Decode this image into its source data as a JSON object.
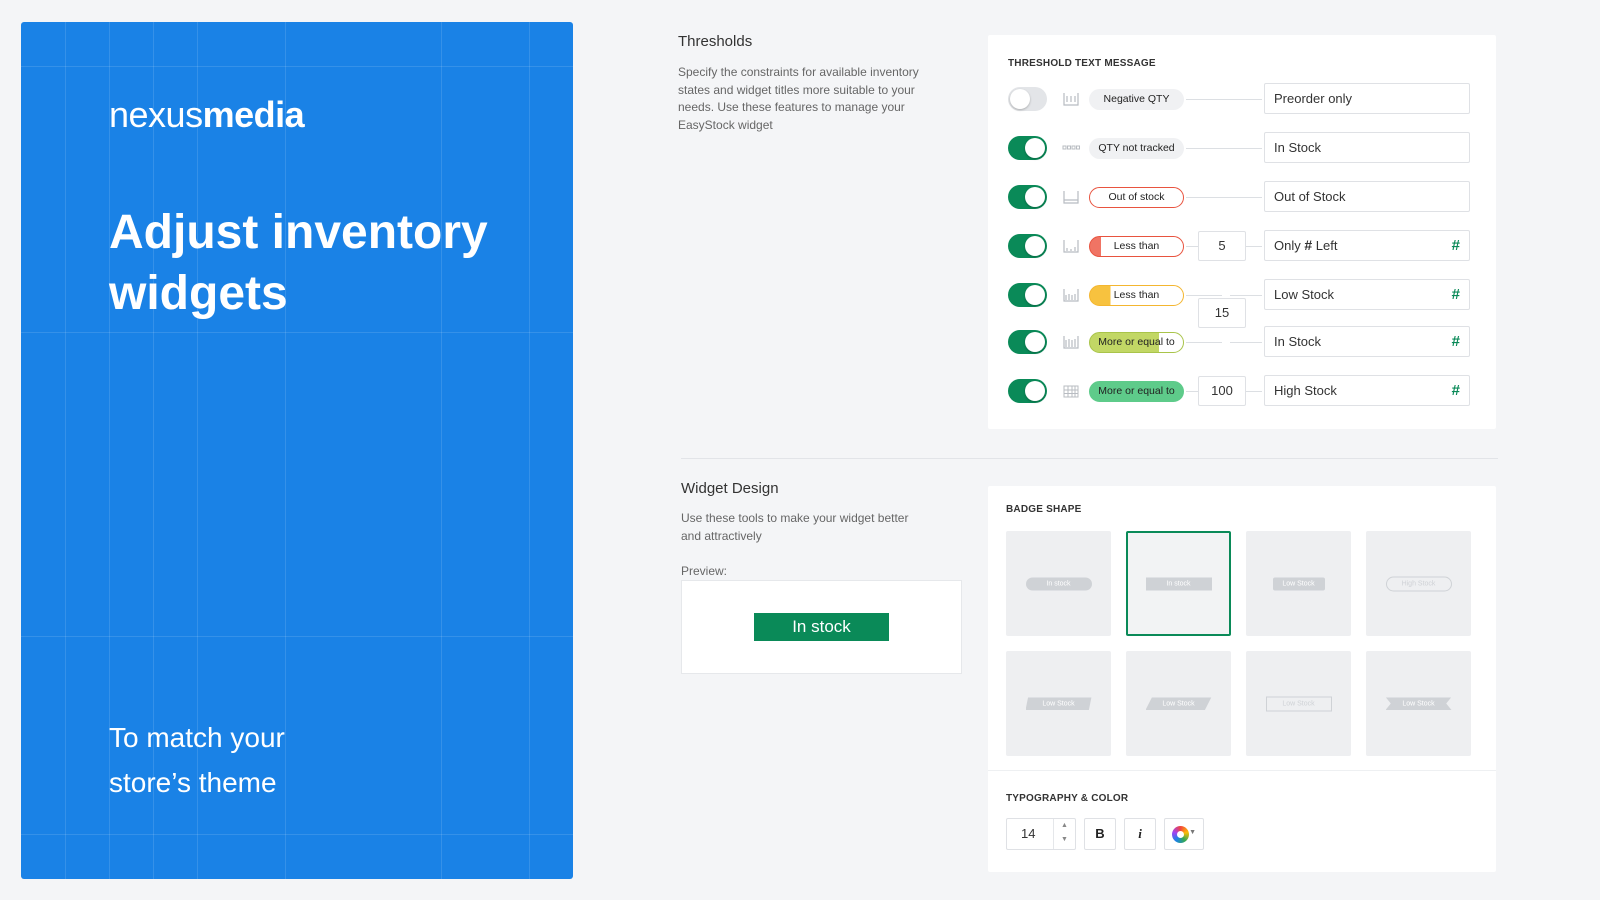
{
  "hero": {
    "brand_light": "nexus",
    "brand_bold": "media",
    "title": "Adjust inventory widgets",
    "subtitle": "To match your store’s theme"
  },
  "thresholds": {
    "title": "Thresholds",
    "description": "Specify the constraints for available inventory states and widget titles more suitable to your needs. Use these features to manage your EasyStock widget",
    "card_label": "THRESHOLD TEXT MESSAGE",
    "rows": [
      {
        "enabled": false,
        "condition": "Negative QTY",
        "value": "",
        "message": "Preorder only"
      },
      {
        "enabled": true,
        "condition": "QTY not tracked",
        "value": "",
        "message": "In Stock"
      },
      {
        "enabled": true,
        "condition": "Out of stock",
        "value": "",
        "message": "Out of Stock"
      },
      {
        "enabled": true,
        "condition": "Less than",
        "value": "5",
        "message_pre": "Only",
        "message_hash": "#",
        "message_post": "Left",
        "hash": "#"
      },
      {
        "enabled": true,
        "condition": "Less than",
        "value": "",
        "message": "Low Stock",
        "hash": "#"
      },
      {
        "enabled": true,
        "condition": "More or equal to",
        "value": "",
        "message": "In Stock",
        "hash": "#"
      },
      {
        "enabled": true,
        "condition": "More or equal to",
        "value": "100",
        "message": "High Stock",
        "hash": "#"
      }
    ],
    "shared_value": "15",
    "colors": {
      "accent": "#0a8a58",
      "danger": "#e8533f",
      "warning": "#f4b630",
      "lime": "#c2d765",
      "success": "#5ecb8a"
    }
  },
  "widget_design": {
    "title": "Widget Design",
    "description": "Use these tools to make your widget better and attractively",
    "preview_label": "Preview:",
    "preview_badge": "In stock",
    "badge_shape_label": "BADGE SHAPE",
    "shapes": [
      {
        "style": "round",
        "label": "In stock",
        "selected": false
      },
      {
        "style": "rect",
        "label": "In stock",
        "selected": true
      },
      {
        "style": "rectsm",
        "label": "Low Stock",
        "selected": false
      },
      {
        "style": "outline",
        "label": "High Stock",
        "selected": false
      },
      {
        "style": "flag",
        "label": "Low Stock",
        "selected": false
      },
      {
        "style": "slant",
        "label": "Low Stock",
        "selected": false
      },
      {
        "style": "outlinerect",
        "label": "Low Stock",
        "selected": false
      },
      {
        "style": "ribbon",
        "label": "Low Stock",
        "selected": false
      }
    ],
    "typography_label": "TYPOGRAPHY & COLOR",
    "font_size": "14",
    "bold_label": "B",
    "italic_label": "i",
    "color_icon": "color-wheel-icon"
  }
}
